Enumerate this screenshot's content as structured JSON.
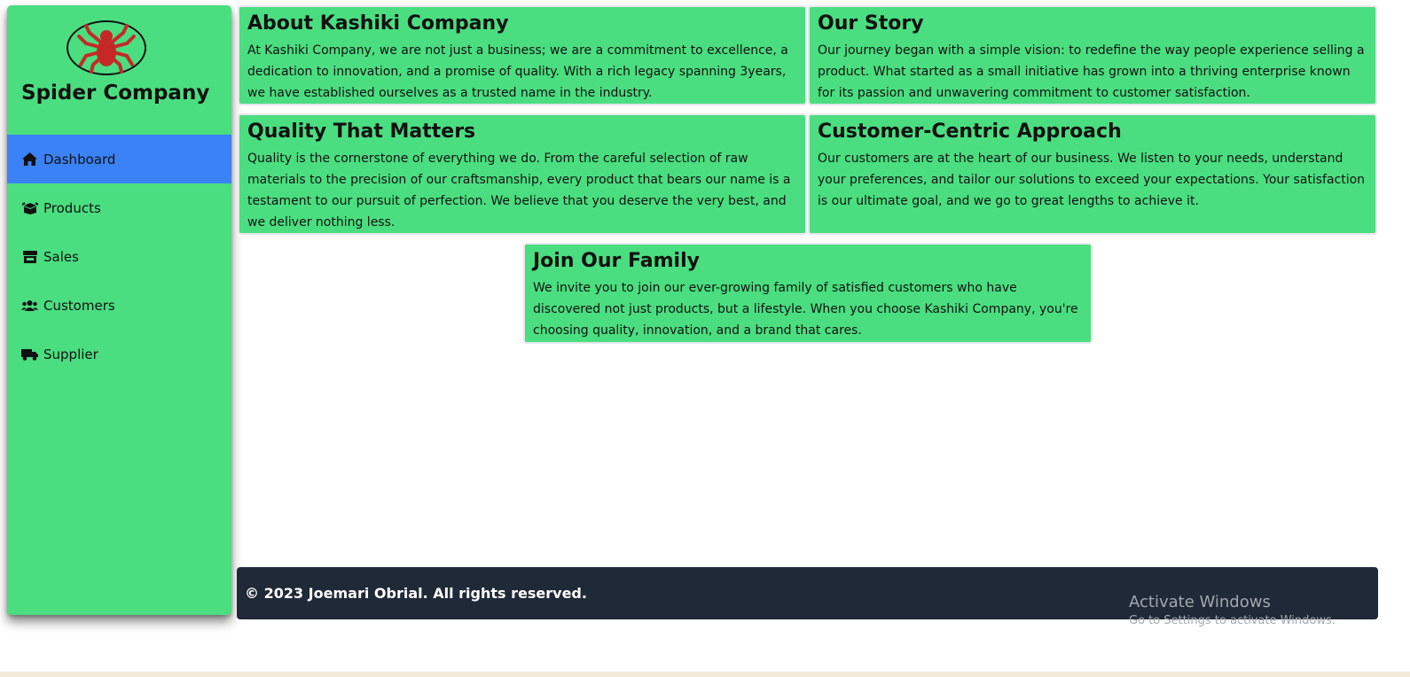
{
  "brand": {
    "name": "Spider Company",
    "logo_icon": "spider-icon",
    "logo_color": "#c62828"
  },
  "sidebar": {
    "items": [
      {
        "label": "Dashboard",
        "icon": "home-icon",
        "active": true
      },
      {
        "label": "Products",
        "icon": "box-icon",
        "active": false
      },
      {
        "label": "Sales",
        "icon": "store-icon",
        "active": false
      },
      {
        "label": "Customers",
        "icon": "users-icon",
        "active": false
      },
      {
        "label": "Supplier",
        "icon": "truck-icon",
        "active": false
      }
    ]
  },
  "cards": [
    {
      "title": "About Kashiki Company",
      "text": "At Kashiki Company, we are not just a business; we are a commitment to excellence, a dedication to innovation, and a promise of quality. With a rich legacy spanning 3years, we have established ourselves as a trusted name in the industry."
    },
    {
      "title": "Our Story",
      "text": "Our journey began with a simple vision: to redefine the way people experience selling a product. What started as a small initiative has grown into a thriving enterprise known for its passion and unwavering commitment to customer satisfaction."
    },
    {
      "title": "Quality That Matters",
      "text": "Quality is the cornerstone of everything we do. From the careful selection of raw materials to the precision of our craftsmanship, every product that bears our name is a testament to our pursuit of perfection. We believe that you deserve the very best, and we deliver nothing less."
    },
    {
      "title": "Customer-Centric Approach",
      "text": "Our customers are at the heart of our business. We listen to your needs, understand your preferences, and tailor our solutions to exceed your expectations. Your satisfaction is our ultimate goal, and we go to great lengths to achieve it."
    },
    {
      "title": "Join Our Family",
      "text": "We invite you to join our ever-growing family of satisfied customers who have discovered not just products, but a lifestyle. When you choose Kashiki Company, you're choosing quality, innovation, and a brand that cares."
    }
  ],
  "footer": {
    "text": "© 2023 Joemari Obrial. All rights reserved."
  },
  "watermark": {
    "line1": "Activate Windows",
    "line2": "Go to Settings to activate Windows."
  },
  "colors": {
    "sidebar_bg": "#4ade80",
    "active_item": "#3b82f6",
    "card_bg": "#4ade80",
    "footer_bg": "#1f2937"
  }
}
